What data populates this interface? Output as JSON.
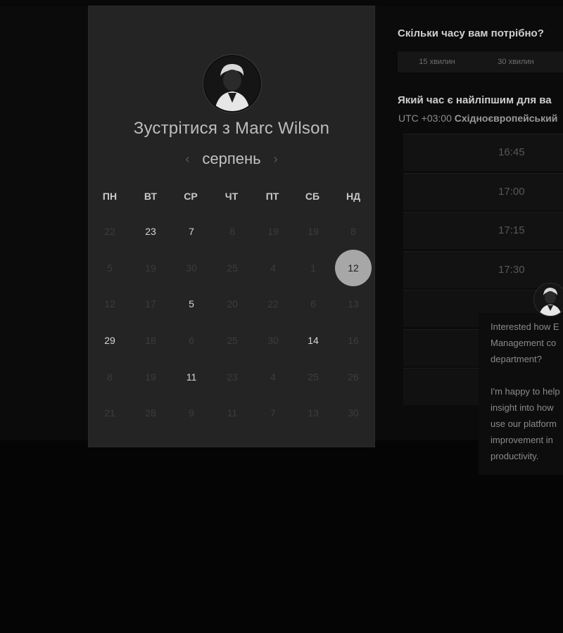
{
  "scheduler": {
    "title": "Зустрітися з Marc Wilson",
    "month": "серпень",
    "prev_icon": "‹",
    "next_icon": "›",
    "weekdays": [
      "ПН",
      "ВТ",
      "СР",
      "ЧТ",
      "ПТ",
      "СБ",
      "НД"
    ],
    "weeks": [
      [
        {
          "d": "22",
          "avail": false
        },
        {
          "d": "23",
          "avail": true
        },
        {
          "d": "7",
          "avail": true
        },
        {
          "d": "8",
          "avail": false
        },
        {
          "d": "19",
          "avail": false
        },
        {
          "d": "19",
          "avail": false
        },
        {
          "d": "8",
          "avail": false
        }
      ],
      [
        {
          "d": "5",
          "avail": false
        },
        {
          "d": "19",
          "avail": false
        },
        {
          "d": "30",
          "avail": false
        },
        {
          "d": "25",
          "avail": false
        },
        {
          "d": "4",
          "avail": false
        },
        {
          "d": "1",
          "avail": false
        },
        {
          "d": "12",
          "avail": true,
          "selected": true
        }
      ],
      [
        {
          "d": "12",
          "avail": false
        },
        {
          "d": "17",
          "avail": false
        },
        {
          "d": "5",
          "avail": true
        },
        {
          "d": "20",
          "avail": false
        },
        {
          "d": "22",
          "avail": false
        },
        {
          "d": "6",
          "avail": false
        },
        {
          "d": "13",
          "avail": false
        }
      ],
      [
        {
          "d": "29",
          "avail": true
        },
        {
          "d": "18",
          "avail": false
        },
        {
          "d": "6",
          "avail": false
        },
        {
          "d": "25",
          "avail": false
        },
        {
          "d": "30",
          "avail": false
        },
        {
          "d": "14",
          "avail": true
        },
        {
          "d": "16",
          "avail": false
        }
      ],
      [
        {
          "d": "8",
          "avail": false
        },
        {
          "d": "19",
          "avail": false
        },
        {
          "d": "11",
          "avail": true
        },
        {
          "d": "23",
          "avail": false
        },
        {
          "d": "4",
          "avail": false
        },
        {
          "d": "25",
          "avail": false
        },
        {
          "d": "26",
          "avail": false
        }
      ],
      [
        {
          "d": "21",
          "avail": false
        },
        {
          "d": "28",
          "avail": false
        },
        {
          "d": "9",
          "avail": false
        },
        {
          "d": "11",
          "avail": false
        },
        {
          "d": "7",
          "avail": false
        },
        {
          "d": "13",
          "avail": false
        },
        {
          "d": "30",
          "avail": false
        }
      ]
    ]
  },
  "duration": {
    "question": "Скільки часу вам потрібно?",
    "options": [
      "15 хвилин",
      "30 хвилин"
    ]
  },
  "time_select": {
    "question": "Який час є найліпшим для ва",
    "tz_prefix": "UTC +03:00",
    "tz_name": "Східноєвропейський",
    "slots": [
      "16:45",
      "17:00",
      "17:15",
      "17:30"
    ]
  },
  "chat": {
    "paragraphs": [
      [
        "Interested how E",
        "Management co",
        "department?"
      ],
      [
        "I'm happy to help",
        "insight into how",
        "use our platform",
        "improvement in",
        "productivity."
      ]
    ]
  },
  "colors": {
    "panel": "#242424",
    "selected_day": "#a7a7a7"
  }
}
